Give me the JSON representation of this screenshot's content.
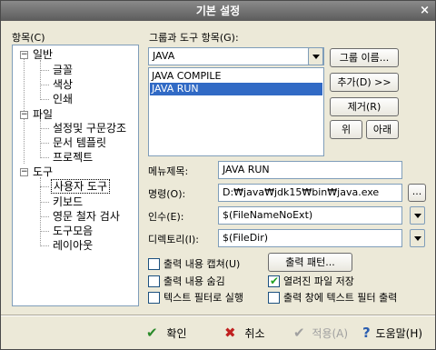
{
  "window": {
    "title": "기본 설정",
    "close_glyph": "×"
  },
  "left": {
    "label": "항목(C)",
    "groups": [
      {
        "label": "일반",
        "expander": "⊟",
        "children": [
          "글꼴",
          "색상",
          "인쇄"
        ]
      },
      {
        "label": "파일",
        "expander": "⊟",
        "children": [
          "설정및 구문강조",
          "문서 템플릿",
          "프로젝트"
        ]
      },
      {
        "label": "도구",
        "expander": "⊟",
        "children": [
          "사용자 도구",
          "키보드",
          "영문 철자 검사",
          "도구모음",
          "레이아웃"
        ]
      }
    ],
    "selected_child": "사용자 도구"
  },
  "right": {
    "group_label": "그룹과 도구 항목(G):",
    "group_value": "JAVA",
    "group_name_button": "그룹 이름...",
    "add_button": "추가(D) >>",
    "remove_button": "제거(R)",
    "up_button": "위",
    "down_button": "아래",
    "tools": [
      "JAVA COMPILE",
      "JAVA RUN"
    ],
    "selected_tool": "JAVA RUN",
    "menu_title_label": "메뉴제목:",
    "menu_title_value": "JAVA RUN",
    "command_label": "명령(O):",
    "command_value": "D:₩java₩jdk15₩bin₩java.exe",
    "browse_button": "...",
    "args_label": "인수(E):",
    "args_value": "$(FileNameNoExt)",
    "dir_label": "디렉토리(I):",
    "dir_value": "$(FileDir)",
    "output_pattern_button": "출력 패턴...",
    "options": [
      {
        "label": "출력 내용 캡쳐(U)",
        "checked": false
      },
      {
        "label": "출력 내용 숨김",
        "checked": false
      },
      {
        "label": "열려진 파일 저장",
        "checked": true
      },
      {
        "label": "텍스트 필터로 실행",
        "checked": false
      },
      {
        "label": "출력 창에 텍스트 필터 출력",
        "checked": false
      }
    ],
    "check_glyph": "✔"
  },
  "footer": {
    "ok": {
      "label": "확인",
      "icon": "checkmark-icon",
      "glyph": "✔",
      "color": "#2a8a2a"
    },
    "cancel": {
      "label": "취소",
      "icon": "x-icon",
      "glyph": "✖",
      "color": "#c02020"
    },
    "apply": {
      "label": "적용(A)",
      "icon": "checkmark-icon",
      "glyph": "✔",
      "disabled": true
    },
    "help": {
      "label": "도움말(H)",
      "icon": "question-icon",
      "glyph": "?"
    }
  },
  "colors": {
    "selection": "#316ac5",
    "field_border": "#7f9db9",
    "dialog_bg": "#ece9d8"
  }
}
